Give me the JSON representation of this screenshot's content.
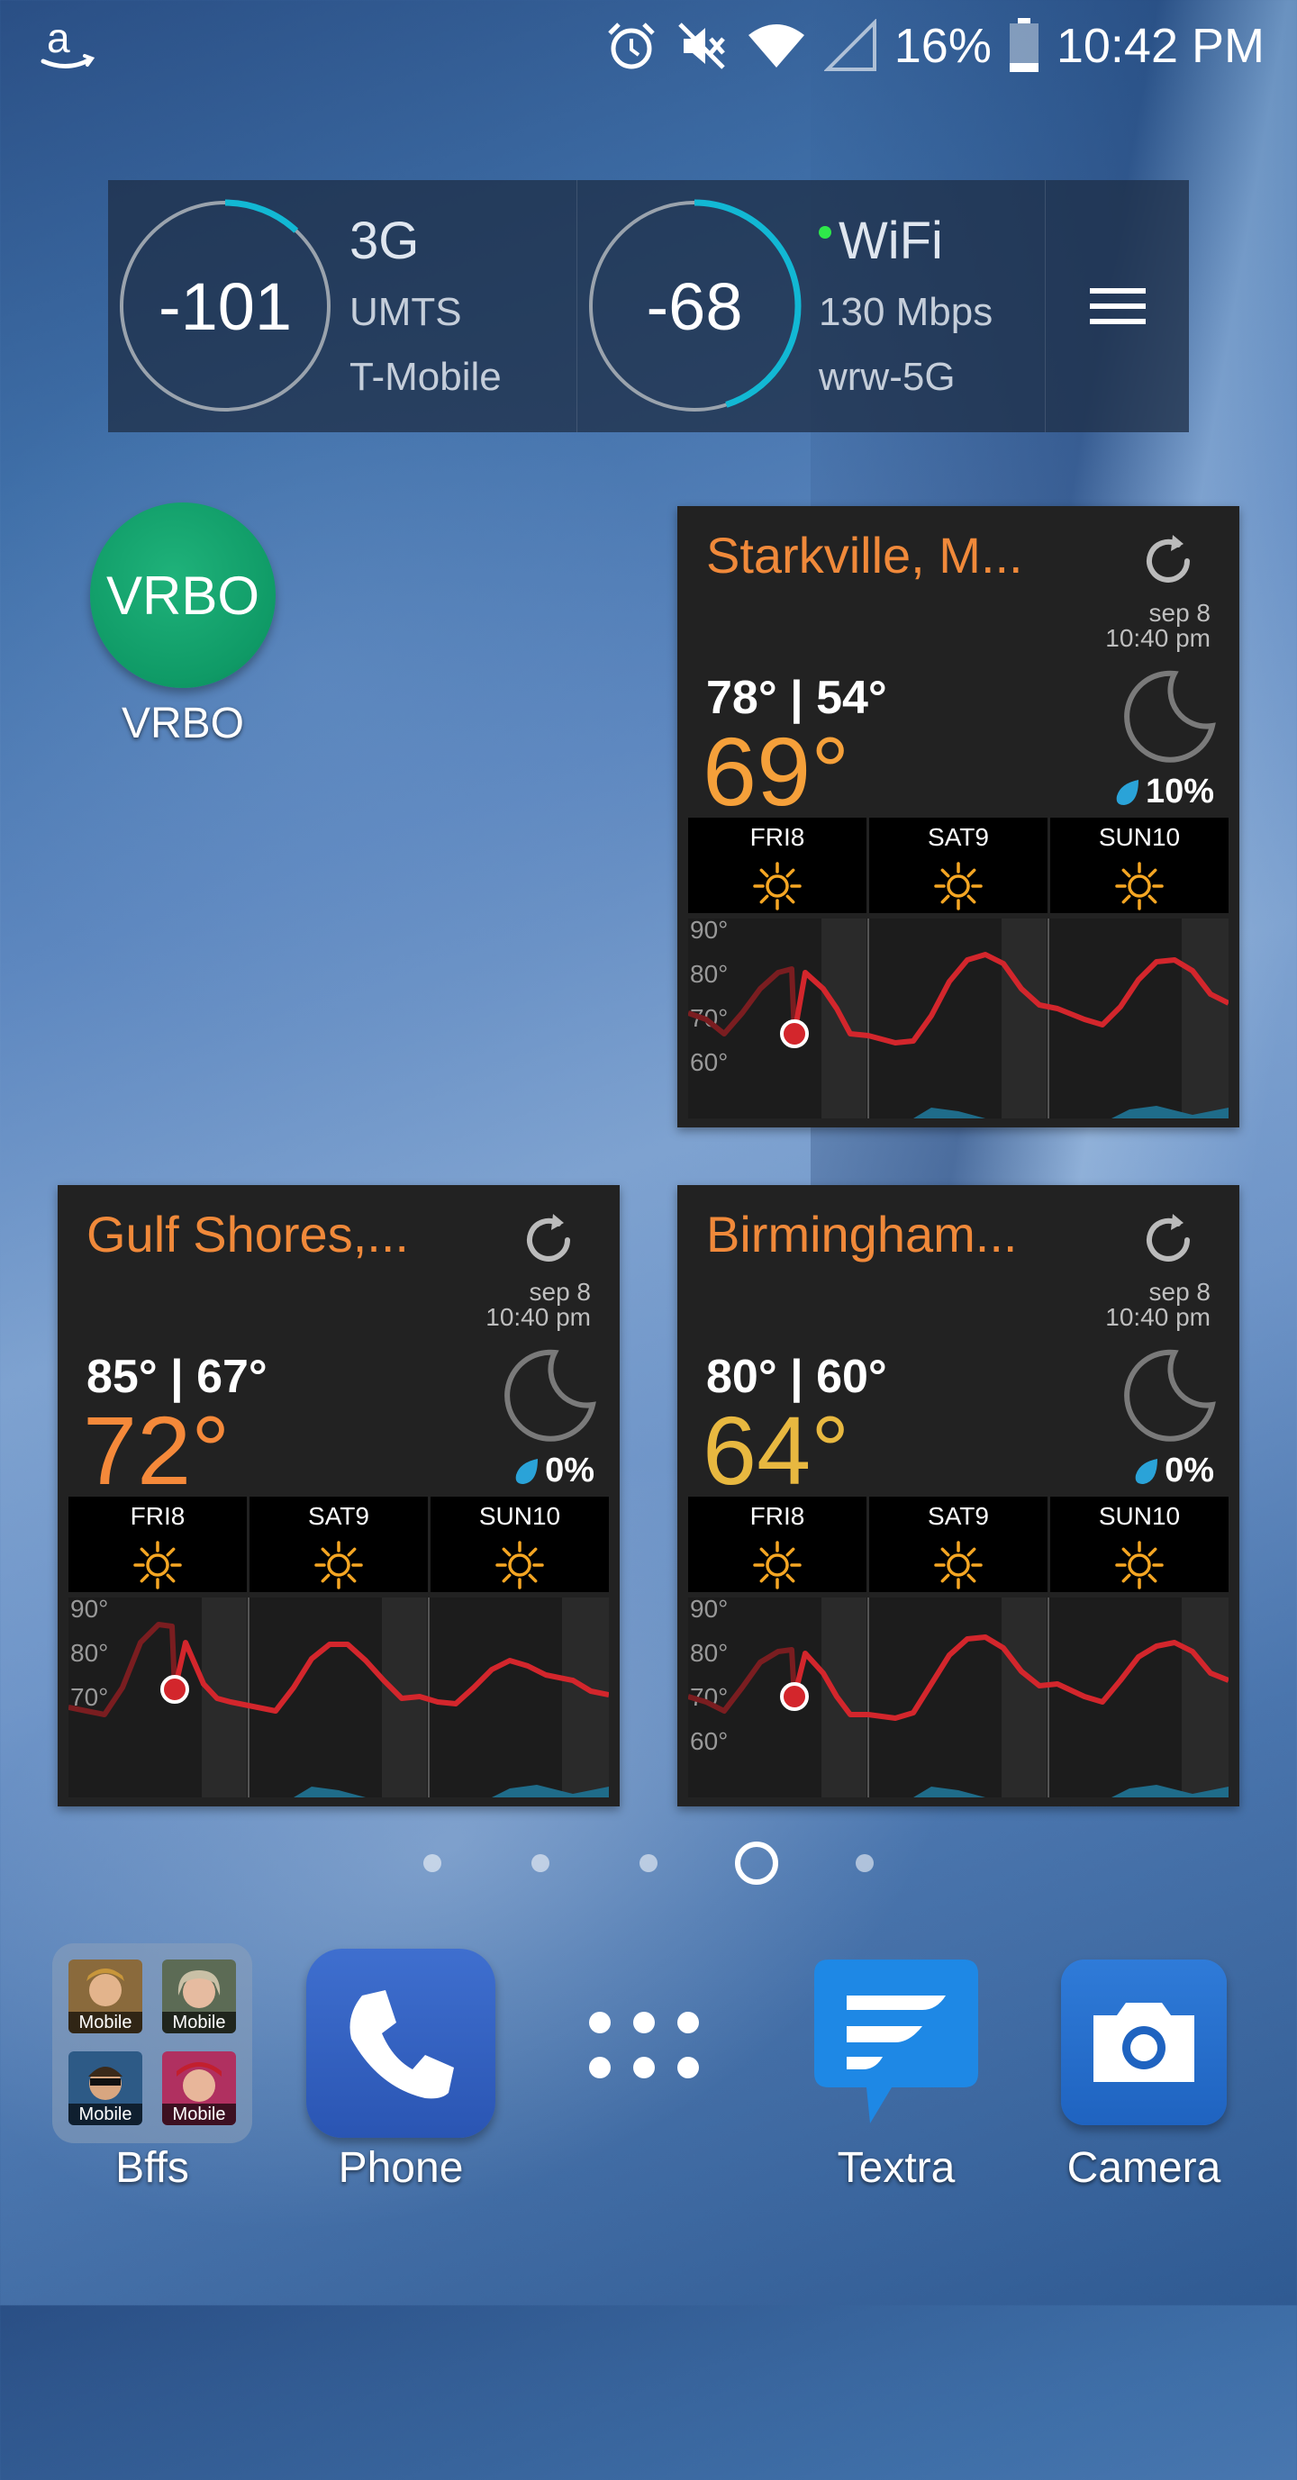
{
  "status_bar": {
    "battery_percent": "16%",
    "time": "10:42 PM",
    "icons": [
      "amazon-icon",
      "alarm-icon",
      "mute-icon",
      "wifi-icon",
      "cell-signal-icon",
      "battery-icon"
    ]
  },
  "network_widget": {
    "cell": {
      "value": "-101",
      "type": "3G",
      "tech": "UMTS",
      "carrier": "T-Mobile",
      "level": 0.12
    },
    "wifi": {
      "value": "-68",
      "type": "WiFi",
      "speed": "130 Mbps",
      "ssid": "wrw-5G",
      "level": 0.45
    },
    "accent_color": "#12b8d4"
  },
  "vrbo": {
    "icon_text": "VRBO",
    "label": "VRBO",
    "color": "#14a06c"
  },
  "weather": [
    {
      "city": "Starkville, M...",
      "date": "sep 8",
      "time": "10:40 pm",
      "hilo": "78° | 54°",
      "temp": "69°",
      "temp_color": "#f5a03a",
      "precip": "10%",
      "days": [
        "FRI8",
        "SAT9",
        "SUN10"
      ],
      "graph_labels": [
        "90°",
        "80°",
        "70°",
        "60°"
      ]
    },
    {
      "city": "Gulf Shores,...",
      "date": "sep 8",
      "time": "10:40 pm",
      "hilo": "85° | 67°",
      "temp": "72°",
      "temp_color": "#f5893a",
      "precip": "0%",
      "days": [
        "FRI8",
        "SAT9",
        "SUN10"
      ],
      "graph_labels": [
        "90°",
        "80°",
        "70°"
      ]
    },
    {
      "city": "Birmingham...",
      "date": "sep 8",
      "time": "10:40 pm",
      "hilo": "80° | 60°",
      "temp": "64°",
      "temp_color": "#e8b840",
      "precip": "0%",
      "days": [
        "FRI8",
        "SAT9",
        "SUN10"
      ],
      "graph_labels": [
        "90°",
        "80°",
        "70°",
        "60°"
      ]
    }
  ],
  "page_indicator": {
    "count": 5,
    "active": 4
  },
  "dock": {
    "folder": {
      "label": "Bffs",
      "contact_tag": "Mobile"
    },
    "phone": {
      "label": "Phone"
    },
    "textra": {
      "label": "Textra"
    },
    "camera": {
      "label": "Camera"
    }
  }
}
